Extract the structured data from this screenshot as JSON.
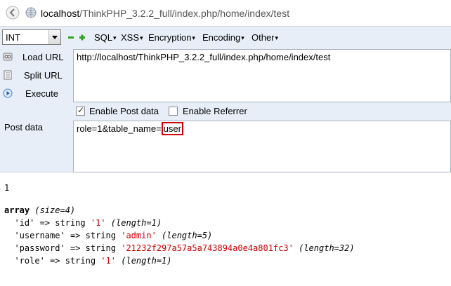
{
  "address_bar": {
    "url_host": "localhost",
    "url_path": "/ThinkPHP_3.2.2_full/index.php/home/index/test"
  },
  "hackbar": {
    "encoding_select": "INT",
    "menus": [
      "SQL",
      "XSS",
      "Encryption",
      "Encoding",
      "Other"
    ],
    "buttons": {
      "load_url": "Load URL",
      "split_url": "Split URL",
      "execute": "Execute"
    },
    "url_value": "http://localhost/ThinkPHP_3.2.2_full/index.php/home/index/test",
    "enable_post_label": "Enable Post data",
    "enable_post_checked": true,
    "enable_referrer_label": "Enable Referrer",
    "enable_referrer_checked": false,
    "post_label": "Post data",
    "post_prefix": "role=1&table_name=",
    "post_highlight": "user"
  },
  "output": {
    "line1": "1",
    "array_kw": "array",
    "array_size": "(size=4)",
    "rows": [
      {
        "key": "'id'",
        "type": "string",
        "value": "'1'",
        "length": "(length=1)"
      },
      {
        "key": "'username'",
        "type": "string",
        "value": "'admin'",
        "length": "(length=5)"
      },
      {
        "key": "'password'",
        "type": "string",
        "value": "'21232f297a57a5a743894a0e4a801fc3'",
        "length": "(length=32)"
      },
      {
        "key": "'role'",
        "type": "string",
        "value": "'1'",
        "length": "(length=1)"
      }
    ],
    "arrow": "=>"
  },
  "colors": {
    "hackbar_bg": "#e7eef7",
    "highlight_border": "#d40000",
    "value_red": "#cc0000"
  }
}
